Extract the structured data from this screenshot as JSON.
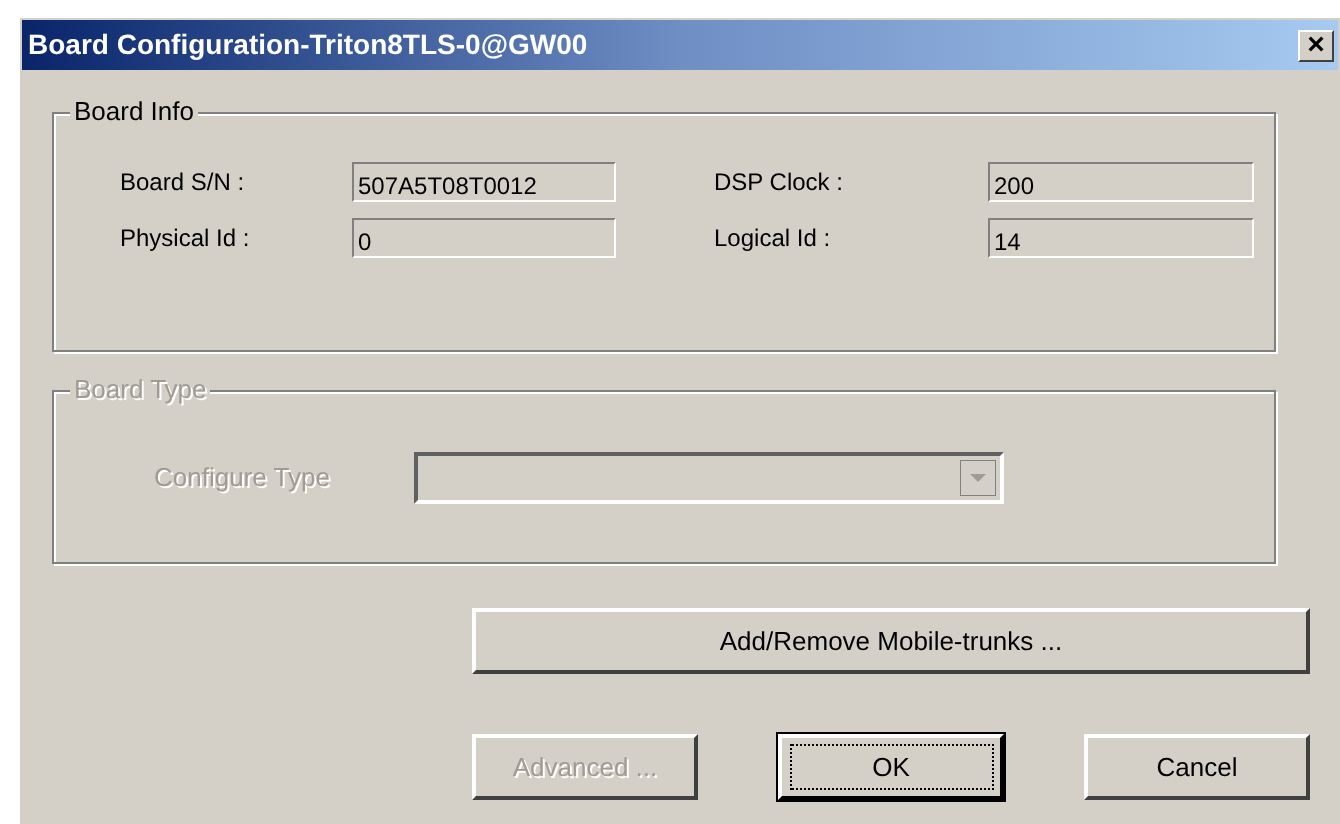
{
  "window": {
    "title": "Board Configuration-Triton8TLS-0@GW00",
    "close": "×"
  },
  "board_info": {
    "title": "Board Info",
    "fields": [
      {
        "label": "Board S/N :",
        "value": "507A5T08T0012"
      },
      {
        "label": "DSP Clock :",
        "value": "200"
      },
      {
        "label": "Physical Id :",
        "value": "0"
      },
      {
        "label": "Logical Id :",
        "value": "14"
      }
    ]
  },
  "board_type": {
    "title": "Board Type",
    "disabled": true,
    "configure_type": {
      "label": "Configure Type"
    }
  },
  "mobile_trunks_button": {
    "label": "Add/Remove Mobile-trunks ...",
    "disabled": false
  },
  "buttons": [
    {
      "label": "Advanced ...",
      "disabled": true,
      "default": false
    },
    {
      "label": "OK",
      "disabled": false,
      "default": true
    },
    {
      "label": "Cancel",
      "disabled": false,
      "default": false
    }
  ]
}
